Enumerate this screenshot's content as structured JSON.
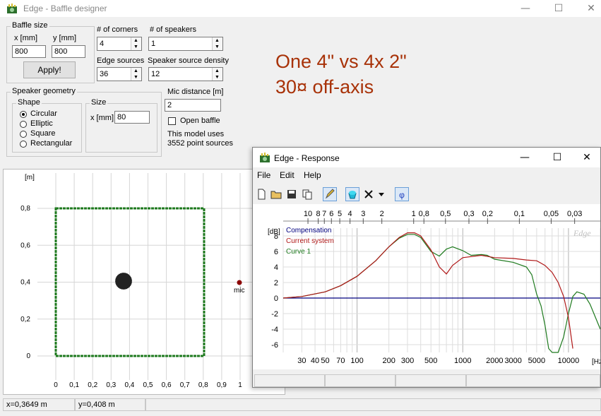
{
  "main_window": {
    "title": "Edge - Baffle designer",
    "controls": {
      "minimize": "—",
      "maximize": "☐",
      "close": "✕"
    }
  },
  "baffle_size": {
    "group_label": "Baffle size",
    "x_label": "x [mm]",
    "y_label": "y [mm]",
    "x_value": "800",
    "y_value": "800",
    "apply_label": "Apply!"
  },
  "corners": {
    "label": "# of corners",
    "value": "4"
  },
  "speakers": {
    "label": "# of speakers",
    "value": "1"
  },
  "edge_sources": {
    "label": "Edge sources",
    "value": "36"
  },
  "source_density": {
    "label": "Speaker source density",
    "value": "12"
  },
  "speaker_geometry": {
    "group_label": "Speaker geometry",
    "shape_label": "Shape",
    "shapes": [
      "Circular",
      "Elliptic",
      "Square",
      "Rectangular"
    ],
    "selected_shape": 0,
    "size_label": "Size",
    "size_x_label": "x [mm]",
    "size_x_value": "80"
  },
  "mic": {
    "distance_label": "Mic distance [m]",
    "distance_value": "2",
    "open_baffle_label": "Open baffle",
    "open_baffle_checked": false,
    "info_line1": "This model uses",
    "info_line2": "3552 point sources"
  },
  "annotation": {
    "line1": "One 4\" vs 4x 2\"",
    "line2": "30¤ off-axis",
    "color": "#a83208"
  },
  "baffle_plot": {
    "unit": "[m]",
    "y_ticks": [
      "0,8",
      "0,6",
      "0,4",
      "0,2",
      "0"
    ],
    "x_ticks": [
      "0",
      "0,1",
      "0,2",
      "0,3",
      "0,4",
      "0,5",
      "0,6",
      "0,7",
      "0,8",
      "0,9",
      "1"
    ],
    "mic_label": "mic",
    "baffle_color": "#1e7a1e"
  },
  "status": {
    "x_readout": "x=0,3649 m",
    "y_readout": "y=0,408 m"
  },
  "response_window": {
    "title": "Edge - Response",
    "controls": {
      "minimize": "—",
      "maximize": "☐",
      "close": "✕"
    },
    "menu": [
      "File",
      "Edit",
      "Help"
    ],
    "toolbar_icons": [
      "new-file-icon",
      "open-folder-icon",
      "save-icon",
      "copy-icon",
      "pencil-icon",
      "bucket-icon",
      "cross-icon",
      "dropdown-arrow-icon",
      "phase-icon"
    ],
    "phase_symbol": "φ",
    "watermark": "Edge"
  },
  "chart_data": {
    "type": "line",
    "ylabel": "[dB]",
    "xlabel": "[Hz]",
    "ylim": [
      -7,
      9
    ],
    "y_ticks": [
      8,
      6,
      4,
      2,
      0,
      -2,
      -4,
      -6
    ],
    "x_ticks_hz": [
      "30",
      "40",
      "50",
      "70",
      "100",
      "200",
      "300",
      "500",
      "1000",
      "2000",
      "3000",
      "5000",
      "10000"
    ],
    "top_axis_ticks": [
      "10",
      "8",
      "7",
      "6",
      "5",
      "4",
      "3",
      "2",
      "1",
      "0,8",
      "0,5",
      "0,3",
      "0,2",
      "0,1",
      "0,05",
      "0,03"
    ],
    "legend": [
      "Compensation",
      "Current system",
      "Curve 1"
    ],
    "grid": true,
    "series": [
      {
        "name": "Compensation",
        "color": "#00007f",
        "x": [
          20,
          20000
        ],
        "y": [
          0,
          0
        ]
      },
      {
        "name": "Current system",
        "color": "#b01818",
        "x": [
          20,
          30,
          50,
          70,
          100,
          150,
          200,
          250,
          300,
          350,
          400,
          500,
          600,
          700,
          800,
          1000,
          1500,
          2000,
          3000,
          4000,
          5000,
          6000,
          7000,
          8000,
          9000,
          10000,
          11000
        ],
        "y": [
          0,
          0.2,
          0.8,
          1.6,
          2.8,
          4.8,
          6.6,
          7.8,
          8.4,
          8.4,
          8.0,
          6.2,
          4.0,
          3.1,
          4.2,
          5.2,
          5.5,
          5.2,
          5.1,
          4.9,
          4.8,
          4.2,
          3.3,
          2.0,
          0.2,
          -2.5,
          -6.5
        ]
      },
      {
        "name": "Curve 1",
        "color": "#1e7a1e",
        "x": [
          20,
          30,
          50,
          70,
          100,
          150,
          200,
          250,
          300,
          350,
          400,
          500,
          600,
          700,
          800,
          1000,
          1200,
          1500,
          1700,
          2000,
          3000,
          4000,
          4500,
          5000,
          5500,
          6000,
          6500,
          7000,
          8000,
          9000,
          10000,
          11000,
          12000,
          14000,
          16000,
          18000,
          20000
        ],
        "y": [
          0,
          0.2,
          0.8,
          1.6,
          2.8,
          4.8,
          6.6,
          7.7,
          8.2,
          8.2,
          7.8,
          6.0,
          5.4,
          6.3,
          6.6,
          6.1,
          5.5,
          5.6,
          5.5,
          5.0,
          4.6,
          4.0,
          3.0,
          0.5,
          -1.0,
          -3.5,
          -6.5,
          -7.0,
          -7.0,
          -5.0,
          -2.0,
          0.2,
          0.8,
          0.5,
          -0.8,
          -2.5,
          -4.0
        ]
      }
    ]
  }
}
